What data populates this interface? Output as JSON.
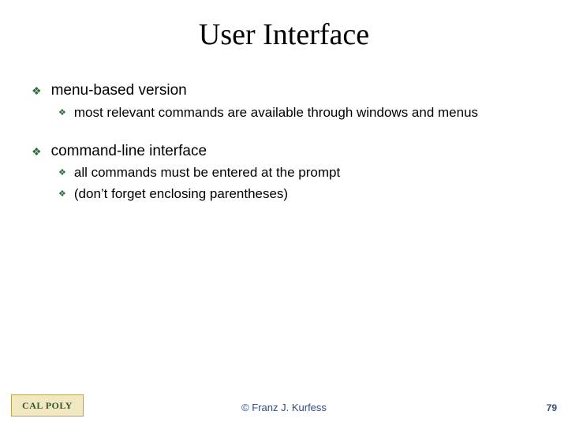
{
  "title": "User Interface",
  "bullets": {
    "b1": "menu-based version",
    "b1_1": "most relevant commands are available through windows and menus",
    "b2": "command-line interface",
    "b2_1": "all commands must be entered at the prompt",
    "b2_2": "(don’t forget enclosing parentheses)"
  },
  "footer": {
    "logo_text": "CAL POLY",
    "copyright": "© Franz J. Kurfess",
    "page_number": "79"
  }
}
